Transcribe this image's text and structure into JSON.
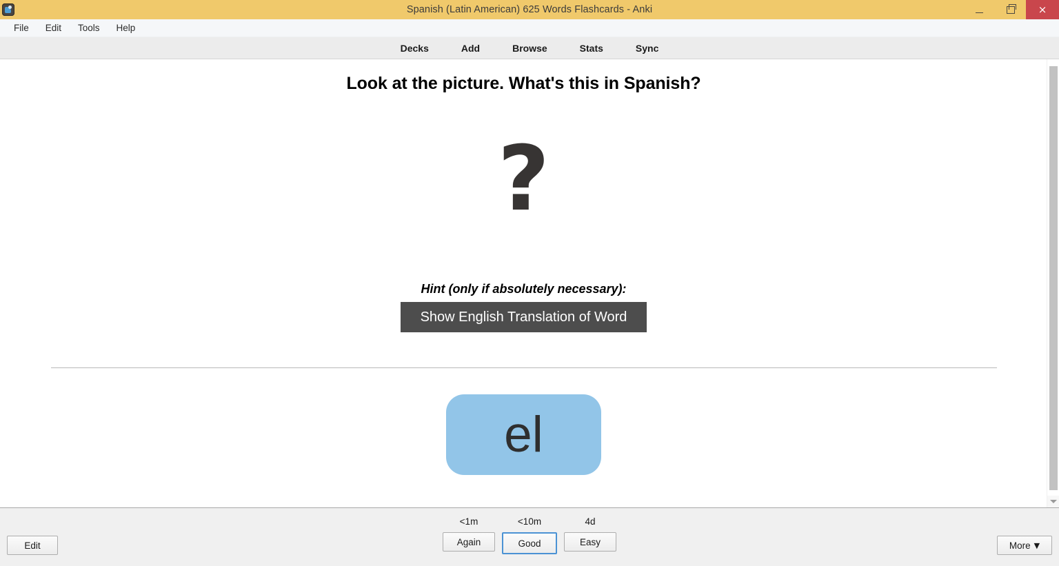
{
  "window": {
    "title": "Spanish (Latin American) 625 Words Flashcards - Anki",
    "icon": "anki-app-icon",
    "controls": {
      "minimize": "minimize-icon",
      "maximize": "restore-icon",
      "close": "×"
    }
  },
  "menubar": {
    "items": [
      {
        "label": "File"
      },
      {
        "label": "Edit"
      },
      {
        "label": "Tools"
      },
      {
        "label": "Help"
      }
    ]
  },
  "toolbar": {
    "items": [
      {
        "label": "Decks"
      },
      {
        "label": "Add"
      },
      {
        "label": "Browse"
      },
      {
        "label": "Stats"
      },
      {
        "label": "Sync"
      }
    ]
  },
  "card": {
    "question": "Look at the picture. What's this in Spanish?",
    "image_placeholder": "?",
    "hint_label": "Hint (only if absolutely necessary):",
    "hint_button": "Show English Translation of Word",
    "answer": "el",
    "answer_bg": "#92c5e8",
    "hint_bg": "#4d4d4d"
  },
  "scrollbar": {
    "down_arrow": "chevron-down-icon"
  },
  "bottombar": {
    "edit_label": "Edit",
    "more_label": "More",
    "more_caret": "▼",
    "ease_buttons": [
      {
        "interval": "<1m",
        "label": "Again",
        "focused": false
      },
      {
        "interval": "<10m",
        "label": "Good",
        "focused": true
      },
      {
        "interval": "4d",
        "label": "Easy",
        "focused": false
      }
    ]
  }
}
